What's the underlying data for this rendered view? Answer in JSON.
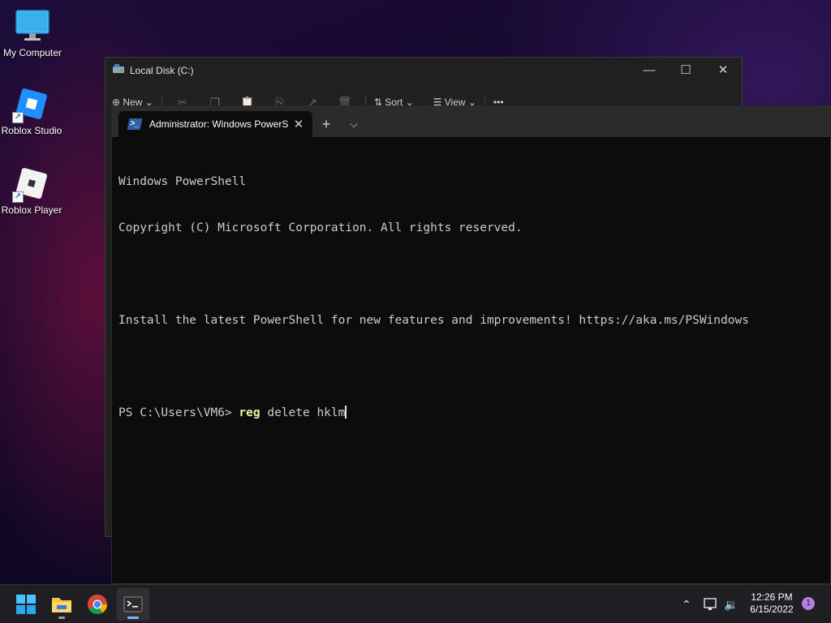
{
  "desktop": {
    "icons": [
      {
        "label": "My Computer",
        "icon": "monitor-icon"
      },
      {
        "label": "Roblox Studio",
        "icon": "roblox-studio-icon"
      },
      {
        "label": "Roblox Player",
        "icon": "roblox-player-icon"
      }
    ]
  },
  "explorer": {
    "title": "Local Disk (C:)",
    "toolbar": {
      "new_label": "New",
      "sort_label": "Sort",
      "view_label": "View",
      "more_label": "•••"
    }
  },
  "terminal": {
    "tab_title": "Administrator: Windows PowerS",
    "new_tab_label": "+",
    "lines": [
      "Windows PowerShell",
      "Copyright (C) Microsoft Corporation. All rights reserved.",
      "",
      "Install the latest PowerShell for new features and improvements! https://aka.ms/PSWindows",
      ""
    ],
    "prompt": "PS C:\\Users\\VM6> ",
    "command": "reg",
    "args": " delete hklm"
  },
  "taskbar": {
    "apps": [
      "start-icon",
      "file-explorer-icon",
      "chrome-icon",
      "terminal-icon"
    ],
    "time": "12:26 PM",
    "date": "6/15/2022",
    "notification_count": "1"
  },
  "colors": {
    "terminal_bg": "#0c0c0c",
    "command_highlight": "#f2f2a0",
    "accent": "#b57ee0"
  }
}
